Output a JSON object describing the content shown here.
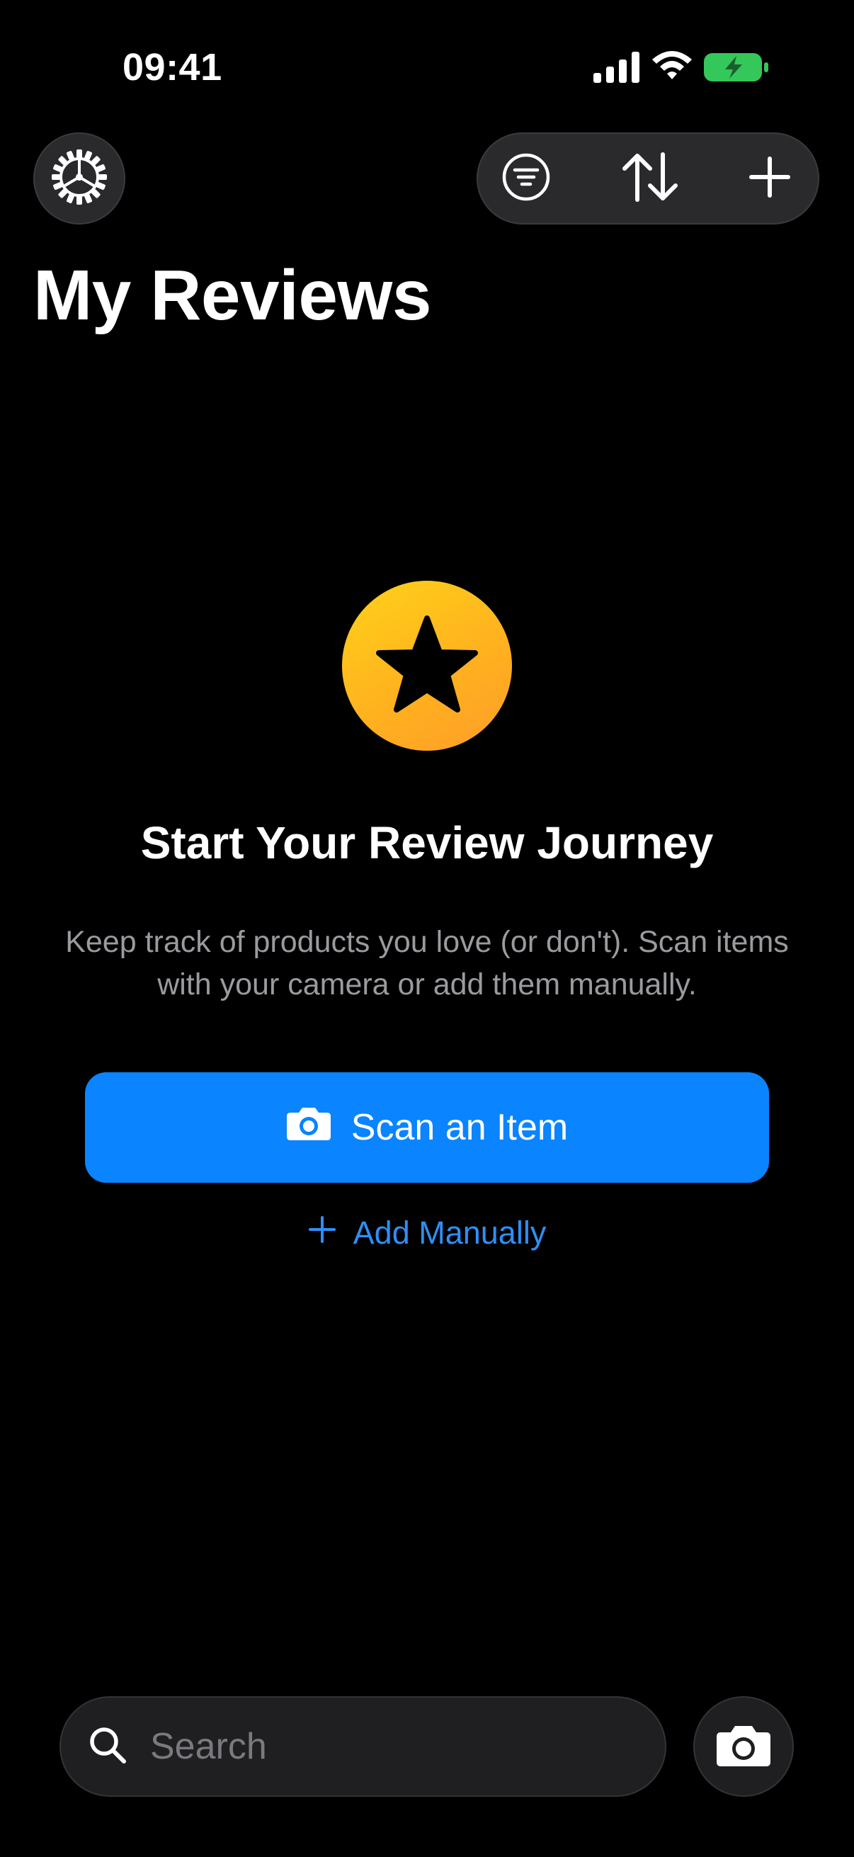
{
  "status_bar": {
    "time": "09:41",
    "icons": [
      "cellular-signal-icon",
      "wifi-icon",
      "battery-charging-icon"
    ],
    "battery_color": "#34c759"
  },
  "toolbar": {
    "settings_icon": "gear-icon",
    "filter_icon": "filter-icon",
    "sort_icon": "sort-icon",
    "add_icon": "plus-icon"
  },
  "page": {
    "title": "My Reviews"
  },
  "empty_state": {
    "icon": "star-icon",
    "title": "Start Your Review Journey",
    "description": "Keep track of products you love (or don't). Scan items with your camera or add them manually.",
    "scan_button_label": "Scan an Item",
    "add_manual_label": "Add Manually"
  },
  "search": {
    "placeholder": "Search",
    "value": ""
  },
  "colors": {
    "background": "#000000",
    "accent": "#0a84ff",
    "star_gradient_start": "#ffd21a",
    "star_gradient_end": "#ff9d2a",
    "secondary_text": "#9a9a9f"
  }
}
